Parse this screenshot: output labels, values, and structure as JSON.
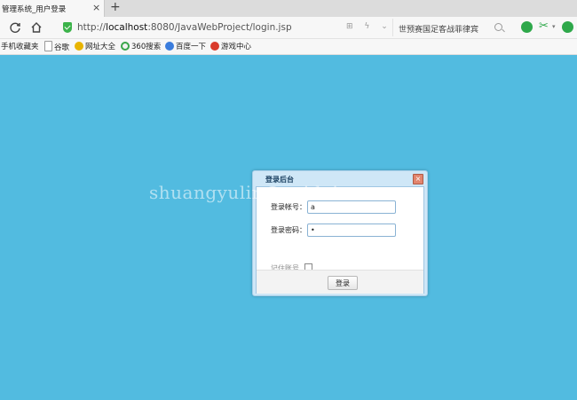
{
  "browser": {
    "tab_title": "管理系统_用户登录",
    "tab_close": "×",
    "new_tab": "+",
    "url_prefix": "http://",
    "url_host": "localhost",
    "url_rest": ":8080/JavaWebProject/login.jsp",
    "url_tools": "⊞ ϟ ⌄",
    "search_text": "世预赛国足客战菲律宾",
    "ext_dropdown": "▾",
    "accent_color": "#2ea84a",
    "bookmarks": [
      {
        "label": "手机收藏夹",
        "icon": "bookmark-icon"
      },
      {
        "label": "谷歌",
        "icon": "page-icon"
      },
      {
        "label": "网址大全",
        "icon": "globe-icon"
      },
      {
        "label": "360搜索",
        "icon": "360-icon"
      },
      {
        "label": "百度一下",
        "icon": "paw-icon"
      },
      {
        "label": "游戏中心",
        "icon": "game-icon"
      }
    ]
  },
  "page": {
    "background_color": "#52bbe0",
    "watermark": "shuangyulin@zuidaima.com"
  },
  "dialog": {
    "title": "登录后台",
    "close": "×",
    "username_label": "登录帐号：",
    "username_value": "a",
    "password_label": "登录密码：",
    "password_value": "•",
    "remember_label": "记住账号",
    "login_button": "登录"
  }
}
